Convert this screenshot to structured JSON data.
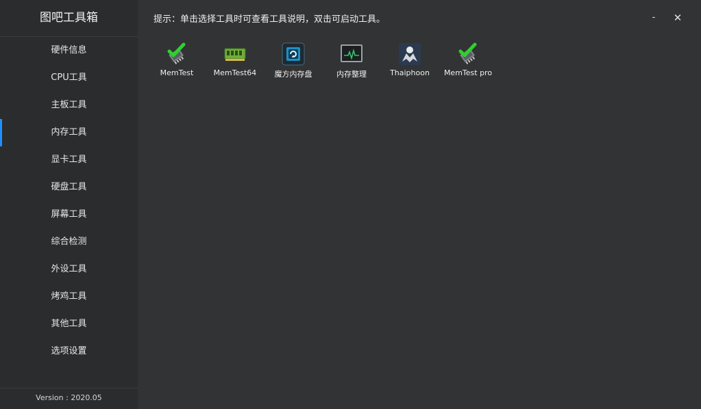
{
  "app": {
    "title": "图吧工具箱",
    "version": "Version : 2020.05"
  },
  "sidebar": {
    "items": [
      {
        "label": "硬件信息"
      },
      {
        "label": "CPU工具"
      },
      {
        "label": "主板工具"
      },
      {
        "label": "内存工具"
      },
      {
        "label": "显卡工具"
      },
      {
        "label": "硬盘工具"
      },
      {
        "label": "屏幕工具"
      },
      {
        "label": "综合检测"
      },
      {
        "label": "外设工具"
      },
      {
        "label": "烤鸡工具"
      },
      {
        "label": "其他工具"
      },
      {
        "label": "选项设置"
      }
    ],
    "active_index": 3,
    "active_color": "#1e90ff"
  },
  "header": {
    "hint": "提示：单击选择工具时可查看工具说明，双击可启动工具。",
    "minimize_label": "-",
    "close_label": "✕"
  },
  "tools": [
    {
      "label": "MemTest",
      "icon": "memtest-icon"
    },
    {
      "label": "MemTest64",
      "icon": "memory-module-icon"
    },
    {
      "label": "魔方内存盘",
      "icon": "ramdisk-chip-icon"
    },
    {
      "label": "内存整理",
      "icon": "monitor-pulse-icon"
    },
    {
      "label": "Thaiphoon",
      "icon": "thaiphoon-icon"
    },
    {
      "label": "MemTest pro",
      "icon": "memtest-pro-icon"
    }
  ]
}
